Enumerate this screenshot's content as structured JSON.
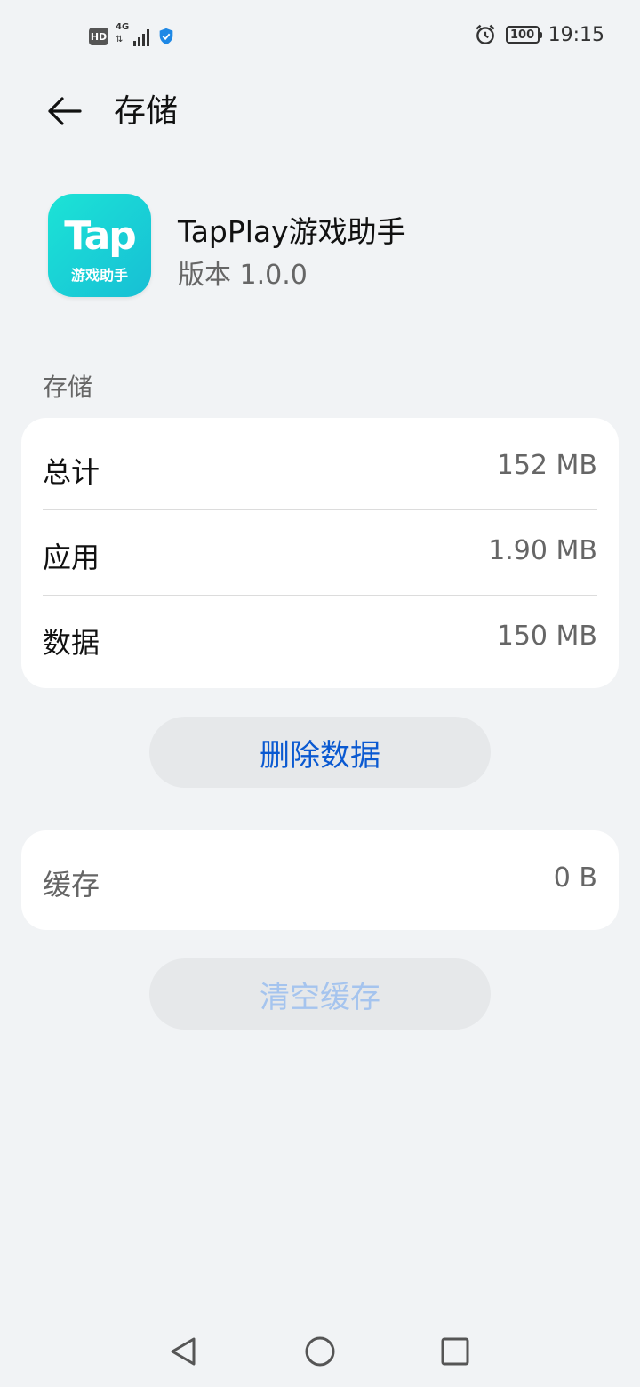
{
  "status_bar": {
    "hd": "HD",
    "network": "4G",
    "battery": "100",
    "time": "19:15"
  },
  "header": {
    "title": "存储"
  },
  "app": {
    "icon_text": "Tap",
    "icon_subtext": "游戏助手",
    "name": "TapPlay游戏助手",
    "version": "版本 1.0.0"
  },
  "storage": {
    "section_label": "存储",
    "rows": [
      {
        "label": "总计",
        "value": "152 MB"
      },
      {
        "label": "应用",
        "value": "1.90 MB"
      },
      {
        "label": "数据",
        "value": "150 MB"
      }
    ],
    "delete_button": "删除数据"
  },
  "cache": {
    "label": "缓存",
    "value": "0 B",
    "clear_button": "清空缓存"
  },
  "colors": {
    "accent": "#0a59d1",
    "accent_disabled": "#a5c4ee",
    "background": "#f1f3f5",
    "icon_gradient_start": "#1ce3d6",
    "icon_gradient_end": "#17bfd5"
  },
  "icons": {
    "back": "arrow-left-icon",
    "alarm": "alarm-icon",
    "shield": "shield-icon",
    "nav_back": "triangle-back-icon",
    "nav_home": "circle-home-icon",
    "nav_recents": "square-recents-icon"
  }
}
